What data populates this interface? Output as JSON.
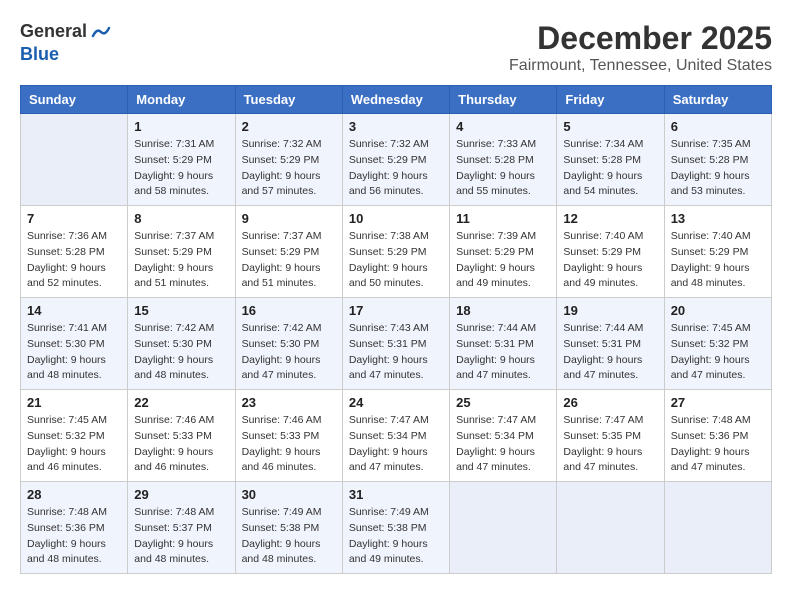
{
  "header": {
    "logo_line1": "General",
    "logo_line2": "Blue",
    "month_title": "December 2025",
    "location": "Fairmount, Tennessee, United States"
  },
  "weekdays": [
    "Sunday",
    "Monday",
    "Tuesday",
    "Wednesday",
    "Thursday",
    "Friday",
    "Saturday"
  ],
  "weeks": [
    [
      {
        "day": "",
        "info": ""
      },
      {
        "day": "1",
        "info": "Sunrise: 7:31 AM\nSunset: 5:29 PM\nDaylight: 9 hours\nand 58 minutes."
      },
      {
        "day": "2",
        "info": "Sunrise: 7:32 AM\nSunset: 5:29 PM\nDaylight: 9 hours\nand 57 minutes."
      },
      {
        "day": "3",
        "info": "Sunrise: 7:32 AM\nSunset: 5:29 PM\nDaylight: 9 hours\nand 56 minutes."
      },
      {
        "day": "4",
        "info": "Sunrise: 7:33 AM\nSunset: 5:28 PM\nDaylight: 9 hours\nand 55 minutes."
      },
      {
        "day": "5",
        "info": "Sunrise: 7:34 AM\nSunset: 5:28 PM\nDaylight: 9 hours\nand 54 minutes."
      },
      {
        "day": "6",
        "info": "Sunrise: 7:35 AM\nSunset: 5:28 PM\nDaylight: 9 hours\nand 53 minutes."
      }
    ],
    [
      {
        "day": "7",
        "info": "Sunrise: 7:36 AM\nSunset: 5:28 PM\nDaylight: 9 hours\nand 52 minutes."
      },
      {
        "day": "8",
        "info": "Sunrise: 7:37 AM\nSunset: 5:29 PM\nDaylight: 9 hours\nand 51 minutes."
      },
      {
        "day": "9",
        "info": "Sunrise: 7:37 AM\nSunset: 5:29 PM\nDaylight: 9 hours\nand 51 minutes."
      },
      {
        "day": "10",
        "info": "Sunrise: 7:38 AM\nSunset: 5:29 PM\nDaylight: 9 hours\nand 50 minutes."
      },
      {
        "day": "11",
        "info": "Sunrise: 7:39 AM\nSunset: 5:29 PM\nDaylight: 9 hours\nand 49 minutes."
      },
      {
        "day": "12",
        "info": "Sunrise: 7:40 AM\nSunset: 5:29 PM\nDaylight: 9 hours\nand 49 minutes."
      },
      {
        "day": "13",
        "info": "Sunrise: 7:40 AM\nSunset: 5:29 PM\nDaylight: 9 hours\nand 48 minutes."
      }
    ],
    [
      {
        "day": "14",
        "info": "Sunrise: 7:41 AM\nSunset: 5:30 PM\nDaylight: 9 hours\nand 48 minutes."
      },
      {
        "day": "15",
        "info": "Sunrise: 7:42 AM\nSunset: 5:30 PM\nDaylight: 9 hours\nand 48 minutes."
      },
      {
        "day": "16",
        "info": "Sunrise: 7:42 AM\nSunset: 5:30 PM\nDaylight: 9 hours\nand 47 minutes."
      },
      {
        "day": "17",
        "info": "Sunrise: 7:43 AM\nSunset: 5:31 PM\nDaylight: 9 hours\nand 47 minutes."
      },
      {
        "day": "18",
        "info": "Sunrise: 7:44 AM\nSunset: 5:31 PM\nDaylight: 9 hours\nand 47 minutes."
      },
      {
        "day": "19",
        "info": "Sunrise: 7:44 AM\nSunset: 5:31 PM\nDaylight: 9 hours\nand 47 minutes."
      },
      {
        "day": "20",
        "info": "Sunrise: 7:45 AM\nSunset: 5:32 PM\nDaylight: 9 hours\nand 47 minutes."
      }
    ],
    [
      {
        "day": "21",
        "info": "Sunrise: 7:45 AM\nSunset: 5:32 PM\nDaylight: 9 hours\nand 46 minutes."
      },
      {
        "day": "22",
        "info": "Sunrise: 7:46 AM\nSunset: 5:33 PM\nDaylight: 9 hours\nand 46 minutes."
      },
      {
        "day": "23",
        "info": "Sunrise: 7:46 AM\nSunset: 5:33 PM\nDaylight: 9 hours\nand 46 minutes."
      },
      {
        "day": "24",
        "info": "Sunrise: 7:47 AM\nSunset: 5:34 PM\nDaylight: 9 hours\nand 47 minutes."
      },
      {
        "day": "25",
        "info": "Sunrise: 7:47 AM\nSunset: 5:34 PM\nDaylight: 9 hours\nand 47 minutes."
      },
      {
        "day": "26",
        "info": "Sunrise: 7:47 AM\nSunset: 5:35 PM\nDaylight: 9 hours\nand 47 minutes."
      },
      {
        "day": "27",
        "info": "Sunrise: 7:48 AM\nSunset: 5:36 PM\nDaylight: 9 hours\nand 47 minutes."
      }
    ],
    [
      {
        "day": "28",
        "info": "Sunrise: 7:48 AM\nSunset: 5:36 PM\nDaylight: 9 hours\nand 48 minutes."
      },
      {
        "day": "29",
        "info": "Sunrise: 7:48 AM\nSunset: 5:37 PM\nDaylight: 9 hours\nand 48 minutes."
      },
      {
        "day": "30",
        "info": "Sunrise: 7:49 AM\nSunset: 5:38 PM\nDaylight: 9 hours\nand 48 minutes."
      },
      {
        "day": "31",
        "info": "Sunrise: 7:49 AM\nSunset: 5:38 PM\nDaylight: 9 hours\nand 49 minutes."
      },
      {
        "day": "",
        "info": ""
      },
      {
        "day": "",
        "info": ""
      },
      {
        "day": "",
        "info": ""
      }
    ]
  ]
}
